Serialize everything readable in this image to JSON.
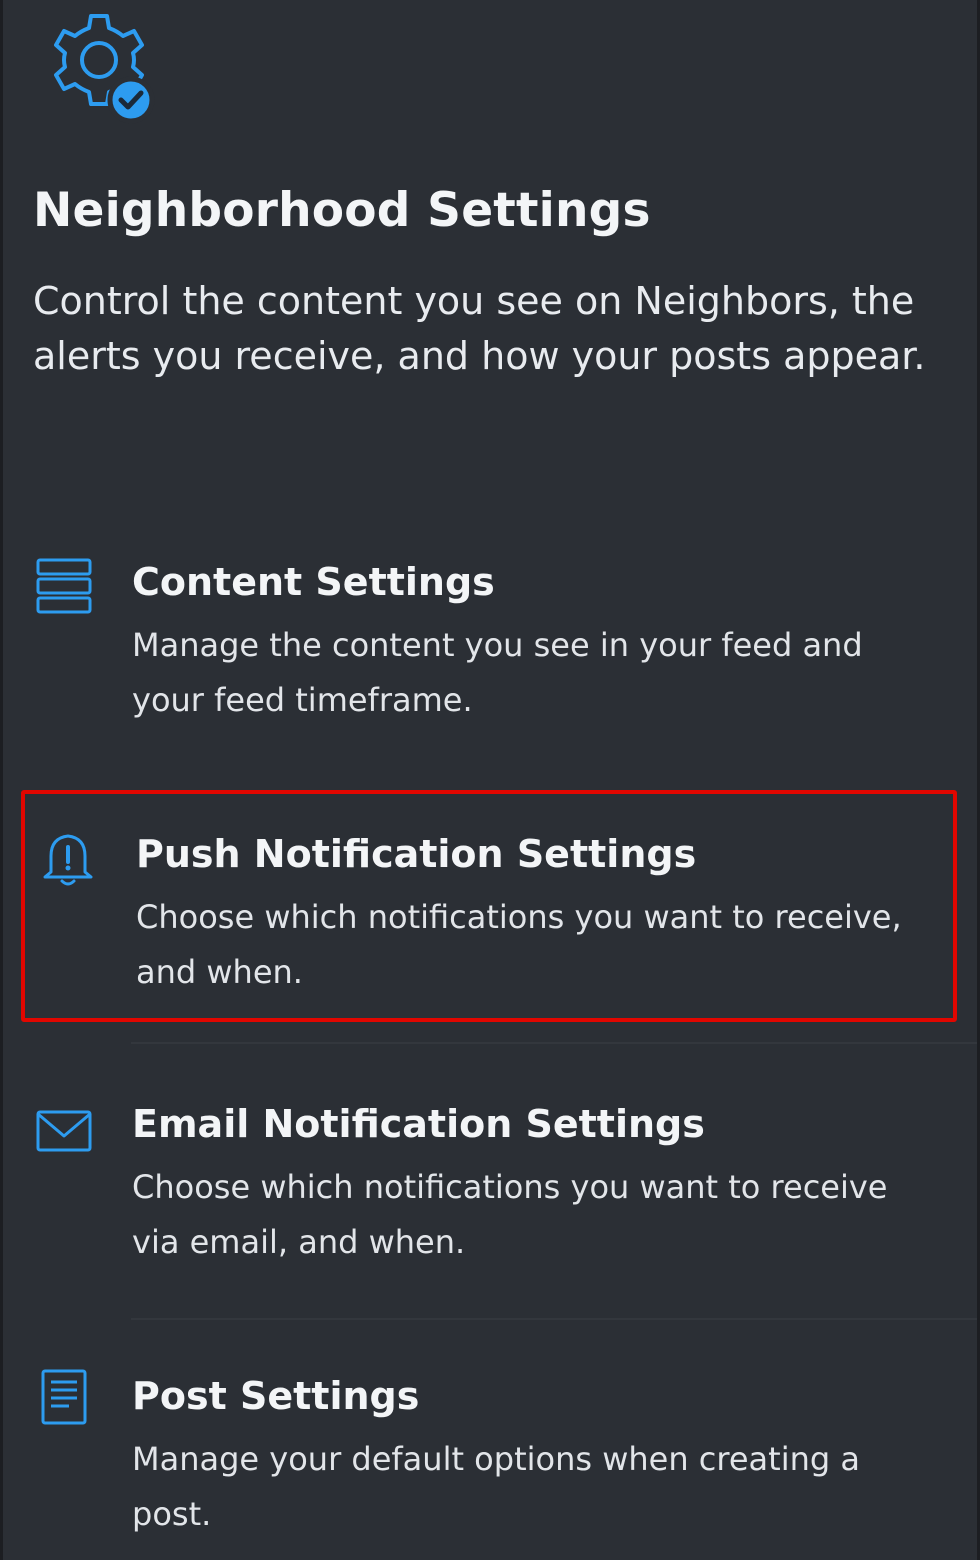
{
  "header": {
    "icon": "gear-check-icon",
    "title": "Neighborhood Settings",
    "description": "Control the content you see on Neighbors, the alerts you receive, and how your posts appear."
  },
  "settings": [
    {
      "icon": "list-icon",
      "title": "Content Settings",
      "description": "Manage the content you see in your feed and your feed timeframe."
    },
    {
      "icon": "bell-alert-icon",
      "title": "Push Notification Settings",
      "description": "Choose which notifications you want to receive, and when.",
      "highlighted": true
    },
    {
      "icon": "envelope-icon",
      "title": "Email Notification Settings",
      "description": "Choose which notifications you want to receive via email, and when."
    },
    {
      "icon": "document-icon",
      "title": "Post Settings",
      "description": "Manage your default options when creating a post."
    }
  ],
  "colors": {
    "background": "#2b2f35",
    "accent": "#2d9cf0",
    "highlight": "#e10600"
  }
}
